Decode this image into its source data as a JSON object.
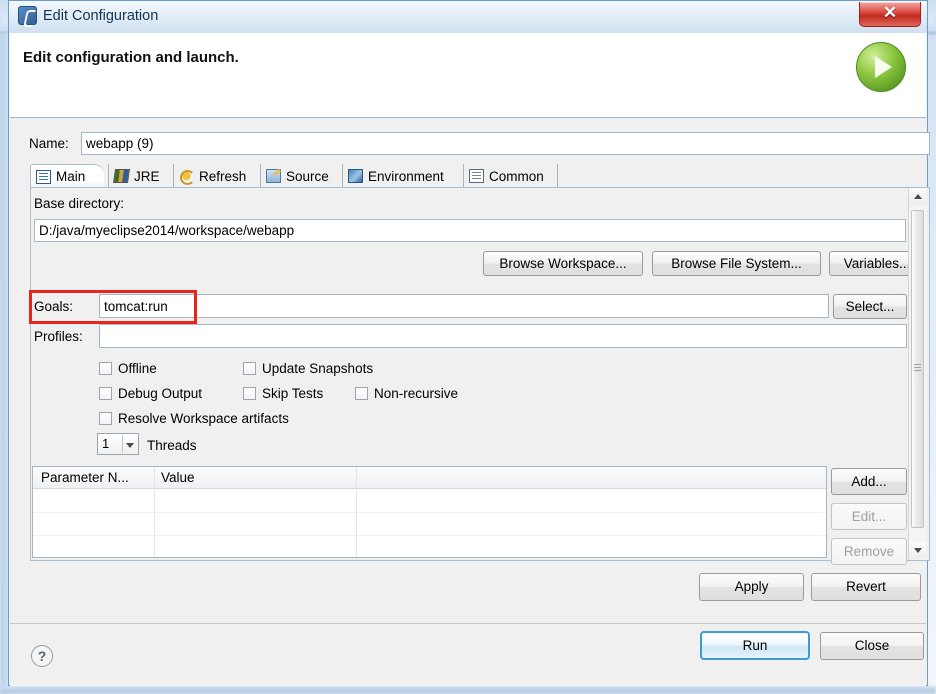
{
  "window": {
    "title": "Edit Configuration",
    "icon": "eclipse-launch-icon",
    "close_label": "✕"
  },
  "header": {
    "title": "Edit configuration and launch.",
    "badge_icon": "green-run-play-icon"
  },
  "name": {
    "label": "Name:",
    "value": "webapp (9)",
    "placeholder": ""
  },
  "tabs": [
    {
      "label": "Main",
      "icon": "document-icon",
      "selected": true
    },
    {
      "label": "JRE",
      "icon": "books-jre-icon",
      "selected": false
    },
    {
      "label": "Refresh",
      "icon": "refresh-icon",
      "selected": false
    },
    {
      "label": "Source",
      "icon": "source-edit-icon",
      "selected": false
    },
    {
      "label": "Environment",
      "icon": "environment-icon",
      "selected": false
    },
    {
      "label": "Common",
      "icon": "common-list-icon",
      "selected": false
    }
  ],
  "main_tab": {
    "base_directory": {
      "label": "Base directory:",
      "value": "D:/java/myeclipse2014/workspace/webapp"
    },
    "dir_buttons": [
      {
        "label": "Browse Workspace...",
        "enabled": true
      },
      {
        "label": "Browse File System...",
        "enabled": true
      },
      {
        "label": "Variables...",
        "enabled": true
      }
    ],
    "goals": {
      "label": "Goals:",
      "value": "tomcat:run",
      "select_button": "Select...",
      "highlighted": true,
      "highlight_color": "#e8241c"
    },
    "profiles": {
      "label": "Profiles:",
      "value": ""
    },
    "checkboxes": [
      {
        "label": "Offline",
        "checked": false
      },
      {
        "label": "Update Snapshots",
        "checked": false
      },
      {
        "label": "Debug Output",
        "checked": false
      },
      {
        "label": "Skip Tests",
        "checked": false
      },
      {
        "label": "Non-recursive",
        "checked": false
      },
      {
        "label": "Resolve Workspace artifacts",
        "checked": false
      }
    ],
    "threads": {
      "value": "1",
      "label": "Threads"
    },
    "parameter_table": {
      "columns": [
        "Parameter N...",
        "Value"
      ],
      "rows": []
    },
    "table_buttons": [
      {
        "label": "Add...",
        "enabled": true
      },
      {
        "label": "Edit...",
        "enabled": false
      },
      {
        "label": "Remove",
        "enabled": false
      }
    ]
  },
  "footer": {
    "apply_label": "Apply",
    "revert_label": "Revert",
    "run_label": "Run",
    "close_label": "Close",
    "help_glyph": "?"
  }
}
